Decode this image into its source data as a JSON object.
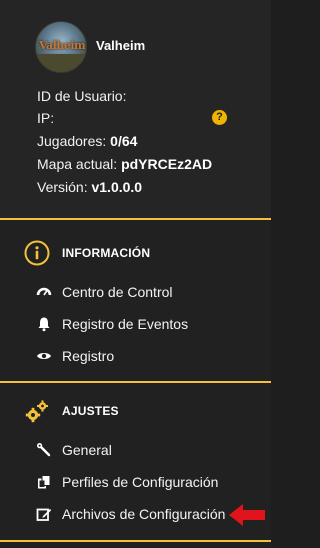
{
  "server": {
    "name": "Valheim",
    "logo_text": "Valheim",
    "user_id_label": "ID de Usuario:",
    "ip_label": "IP:",
    "ip_help_icon": "question-circle-icon",
    "players_label": "Jugadores:",
    "players_value": "0/64",
    "map_label": "Mapa actual:",
    "map_value": "pdYRCEz2AD",
    "version_label": "Versión:",
    "version_value": "v1.0.0.0"
  },
  "sections": {
    "info": {
      "title": "INFORMACIÓN",
      "icon": "info-circle-icon",
      "items": [
        {
          "label": "Centro de Control",
          "icon": "dashboard-gauge-icon"
        },
        {
          "label": "Registro de Eventos",
          "icon": "bell-icon"
        },
        {
          "label": "Registro",
          "icon": "eye-icon"
        }
      ]
    },
    "settings": {
      "title": "AJUSTES",
      "icon": "gears-icon",
      "items": [
        {
          "label": "General",
          "icon": "wrench-icon"
        },
        {
          "label": "Perfiles de Configuración",
          "icon": "copy-files-icon"
        },
        {
          "label": "Archivos de Configuración",
          "icon": "edit-icon"
        }
      ]
    }
  },
  "colors": {
    "accent": "#f3c13a",
    "background": "#212121",
    "annotation_arrow": "#e0141a"
  }
}
